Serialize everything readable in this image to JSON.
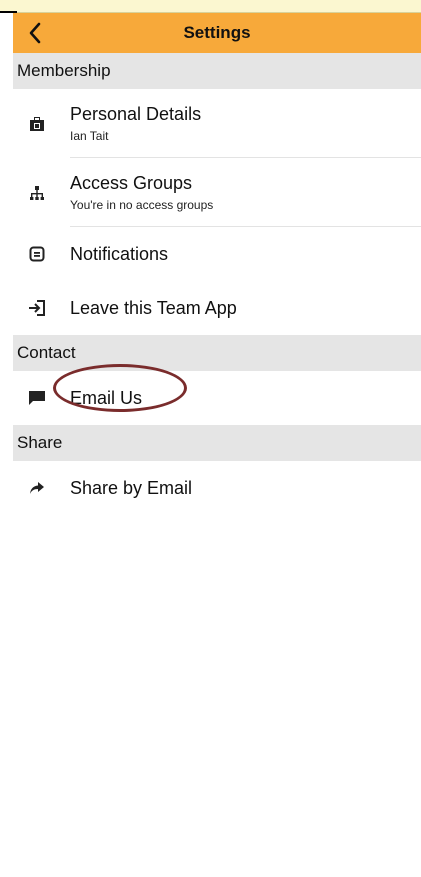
{
  "header": {
    "title": "Settings",
    "back_icon": "chevron-left-icon"
  },
  "colors": {
    "header_bg": "#f7a93a",
    "section_bg": "#e5e5e5",
    "annotation_circle": "#7a2c2c"
  },
  "sections": [
    {
      "title": "Membership",
      "items": [
        {
          "label": "Personal Details",
          "sublabel": "Ian Tait",
          "icon": "id-badge-icon"
        },
        {
          "label": "Access Groups",
          "sublabel": "You're in no access groups",
          "icon": "org-chart-icon"
        },
        {
          "label": "Notifications",
          "icon": "message-box-icon"
        },
        {
          "label": "Leave this Team App",
          "icon": "exit-door-icon"
        }
      ]
    },
    {
      "title": "Contact",
      "items": [
        {
          "label": "Email Us",
          "icon": "chat-bubble-icon"
        }
      ]
    },
    {
      "title": "Share",
      "items": [
        {
          "label": "Share by Email",
          "icon": "share-arrow-icon"
        }
      ]
    }
  ]
}
